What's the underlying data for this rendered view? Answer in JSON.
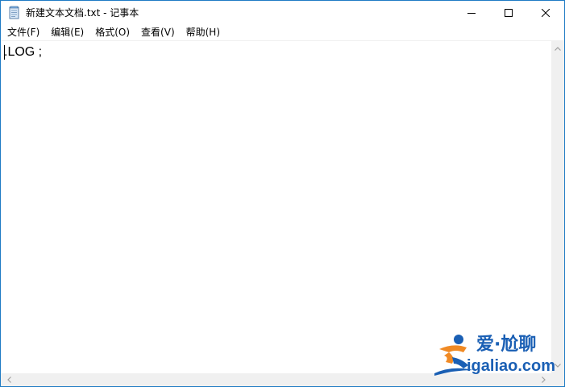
{
  "window": {
    "title": "新建文本文档.txt - 记事本"
  },
  "menu": {
    "items": [
      {
        "label": "文件(F)"
      },
      {
        "label": "编辑(E)"
      },
      {
        "label": "格式(O)"
      },
      {
        "label": "查看(V)"
      },
      {
        "label": "帮助(H)"
      }
    ]
  },
  "editor": {
    "content": ".LOG ;"
  },
  "watermark": {
    "top_text": "爱·尬聊",
    "bottom_text": "igaliao.com"
  },
  "icons": {
    "app": "notepad-icon",
    "minimize": "minimize-icon",
    "maximize": "maximize-icon",
    "close": "close-icon",
    "scroll_up": "arrow-up-icon",
    "scroll_down": "arrow-down-icon",
    "scroll_left": "arrow-left-icon",
    "scroll_right": "arrow-right-icon"
  },
  "colors": {
    "window_border": "#1f7bc4",
    "scrollbar": "#f0f0f0",
    "watermark_blue": "#1a5fb4",
    "watermark_orange": "#f08a24"
  }
}
